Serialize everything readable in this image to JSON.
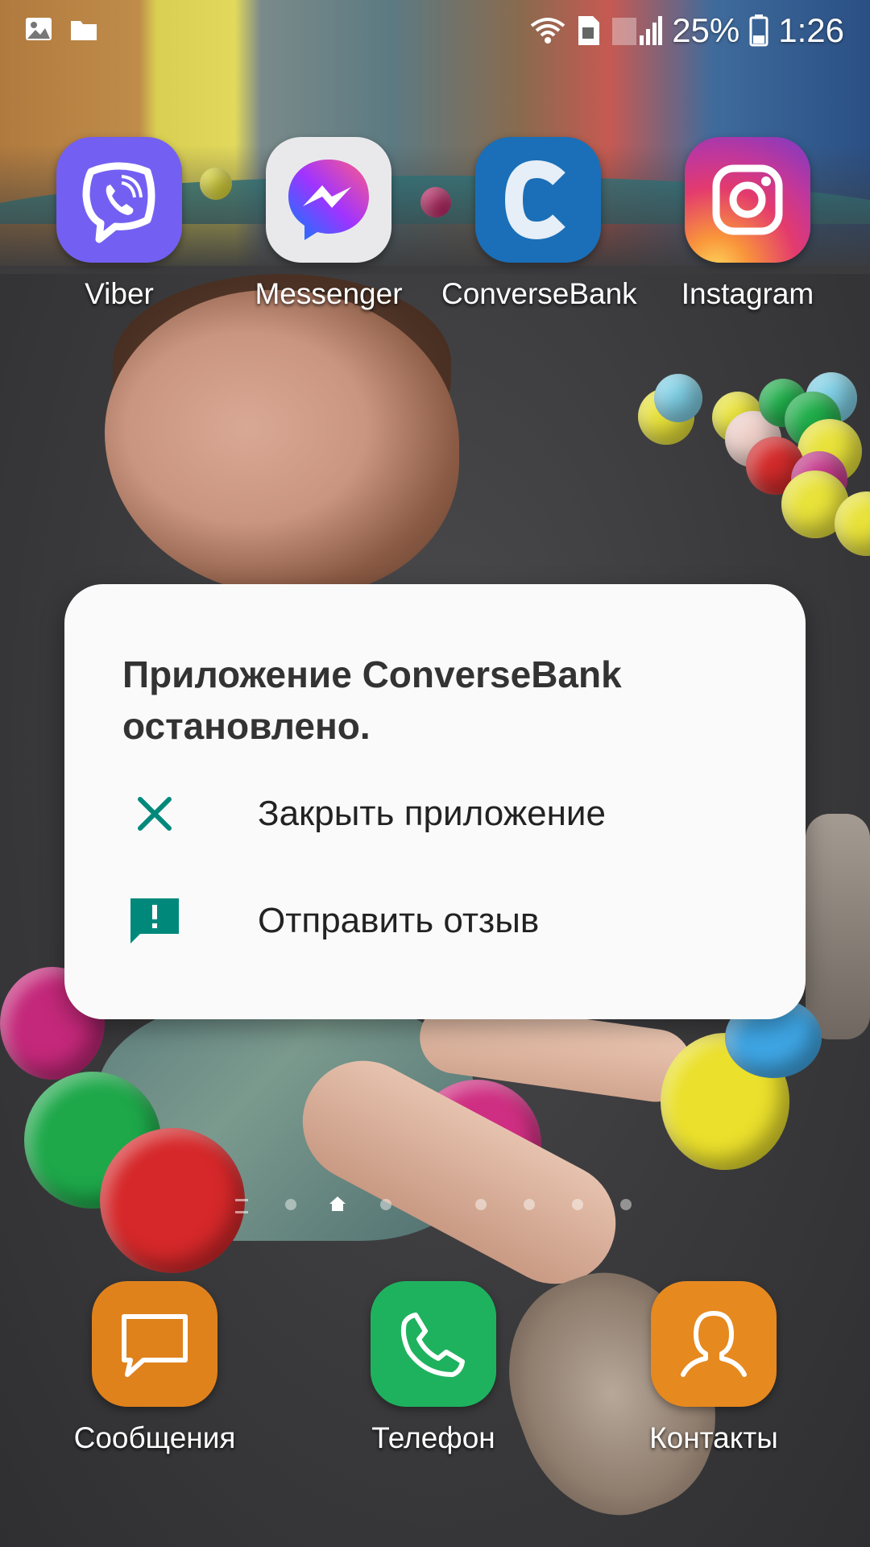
{
  "status_bar": {
    "left_icons": [
      "gallery-icon",
      "folder-icon"
    ],
    "battery_percent": "25%",
    "time": "1:26"
  },
  "apps": [
    {
      "label": "Viber",
      "icon": "viber-icon",
      "color": "#7360f2"
    },
    {
      "label": "Messenger",
      "icon": "messenger-icon",
      "color": "#a033ff"
    },
    {
      "label": "ConverseBank",
      "icon": "conversebank-icon",
      "color": "#1a6fb8"
    },
    {
      "label": "Instagram",
      "icon": "instagram-icon",
      "color": "#e33a6e"
    }
  ],
  "dock": [
    {
      "label": "Сообщения",
      "icon": "messages-icon",
      "color": "#e0821c"
    },
    {
      "label": "Телефон",
      "icon": "phone-icon",
      "color": "#1fb25e"
    },
    {
      "label": "Контакты",
      "icon": "contacts-icon",
      "color": "#e6891f"
    }
  ],
  "dialog": {
    "title": "Приложение ConverseBank остановлено.",
    "options": [
      {
        "label": "Закрыть приложение",
        "icon": "close-icon"
      },
      {
        "label": "Отправить отзыв",
        "icon": "feedback-icon"
      }
    ],
    "accent_color": "#00897b"
  }
}
